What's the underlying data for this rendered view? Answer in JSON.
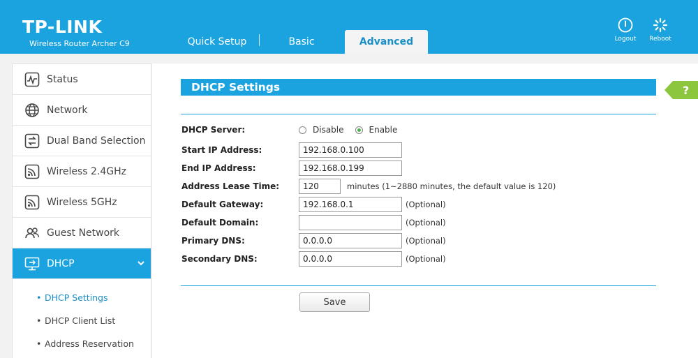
{
  "header": {
    "logo": "TP-LINK",
    "model": "Wireless Router Archer C9",
    "tabs": [
      {
        "label": "Quick Setup"
      },
      {
        "label": "Basic"
      },
      {
        "label": "Advanced"
      }
    ],
    "logout_label": "Logout",
    "reboot_label": "Reboot"
  },
  "sidebar": {
    "items": [
      {
        "label": "Status",
        "icon": "status-icon"
      },
      {
        "label": "Network",
        "icon": "globe-icon"
      },
      {
        "label": "Dual Band Selection",
        "icon": "dual-band-icon"
      },
      {
        "label": "Wireless 2.4GHz",
        "icon": "wireless-icon"
      },
      {
        "label": "Wireless 5GHz",
        "icon": "wireless-icon"
      },
      {
        "label": "Guest Network",
        "icon": "guest-icon"
      },
      {
        "label": "DHCP",
        "icon": "dhcp-icon"
      }
    ],
    "sub_items": [
      {
        "label": "DHCP Settings"
      },
      {
        "label": "DHCP Client List"
      },
      {
        "label": "Address Reservation"
      }
    ]
  },
  "panel": {
    "title": "DHCP Settings",
    "help_label": "?",
    "fields": {
      "dhcp_server": {
        "label": "DHCP Server:",
        "options": [
          "Disable",
          "Enable"
        ],
        "selected": "Enable"
      },
      "start_ip": {
        "label": "Start IP Address:",
        "value": "192.168.0.100"
      },
      "end_ip": {
        "label": "End IP Address:",
        "value": "192.168.0.199"
      },
      "lease_time": {
        "label": "Address Lease Time:",
        "value": "120",
        "hint": "minutes (1~2880 minutes, the default value is 120)"
      },
      "gateway": {
        "label": "Default Gateway:",
        "value": "192.168.0.1",
        "hint": "(Optional)"
      },
      "domain": {
        "label": "Default Domain:",
        "value": "",
        "hint": "(Optional)"
      },
      "primary_dns": {
        "label": "Primary DNS:",
        "value": "0.0.0.0",
        "hint": "(Optional)"
      },
      "secondary_dns": {
        "label": "Secondary DNS:",
        "value": "0.0.0.0",
        "hint": "(Optional)"
      }
    },
    "save_label": "Save"
  },
  "colors": {
    "accent": "#1aa3de",
    "help": "#8cc63f",
    "radio_on": "#4caf50"
  }
}
